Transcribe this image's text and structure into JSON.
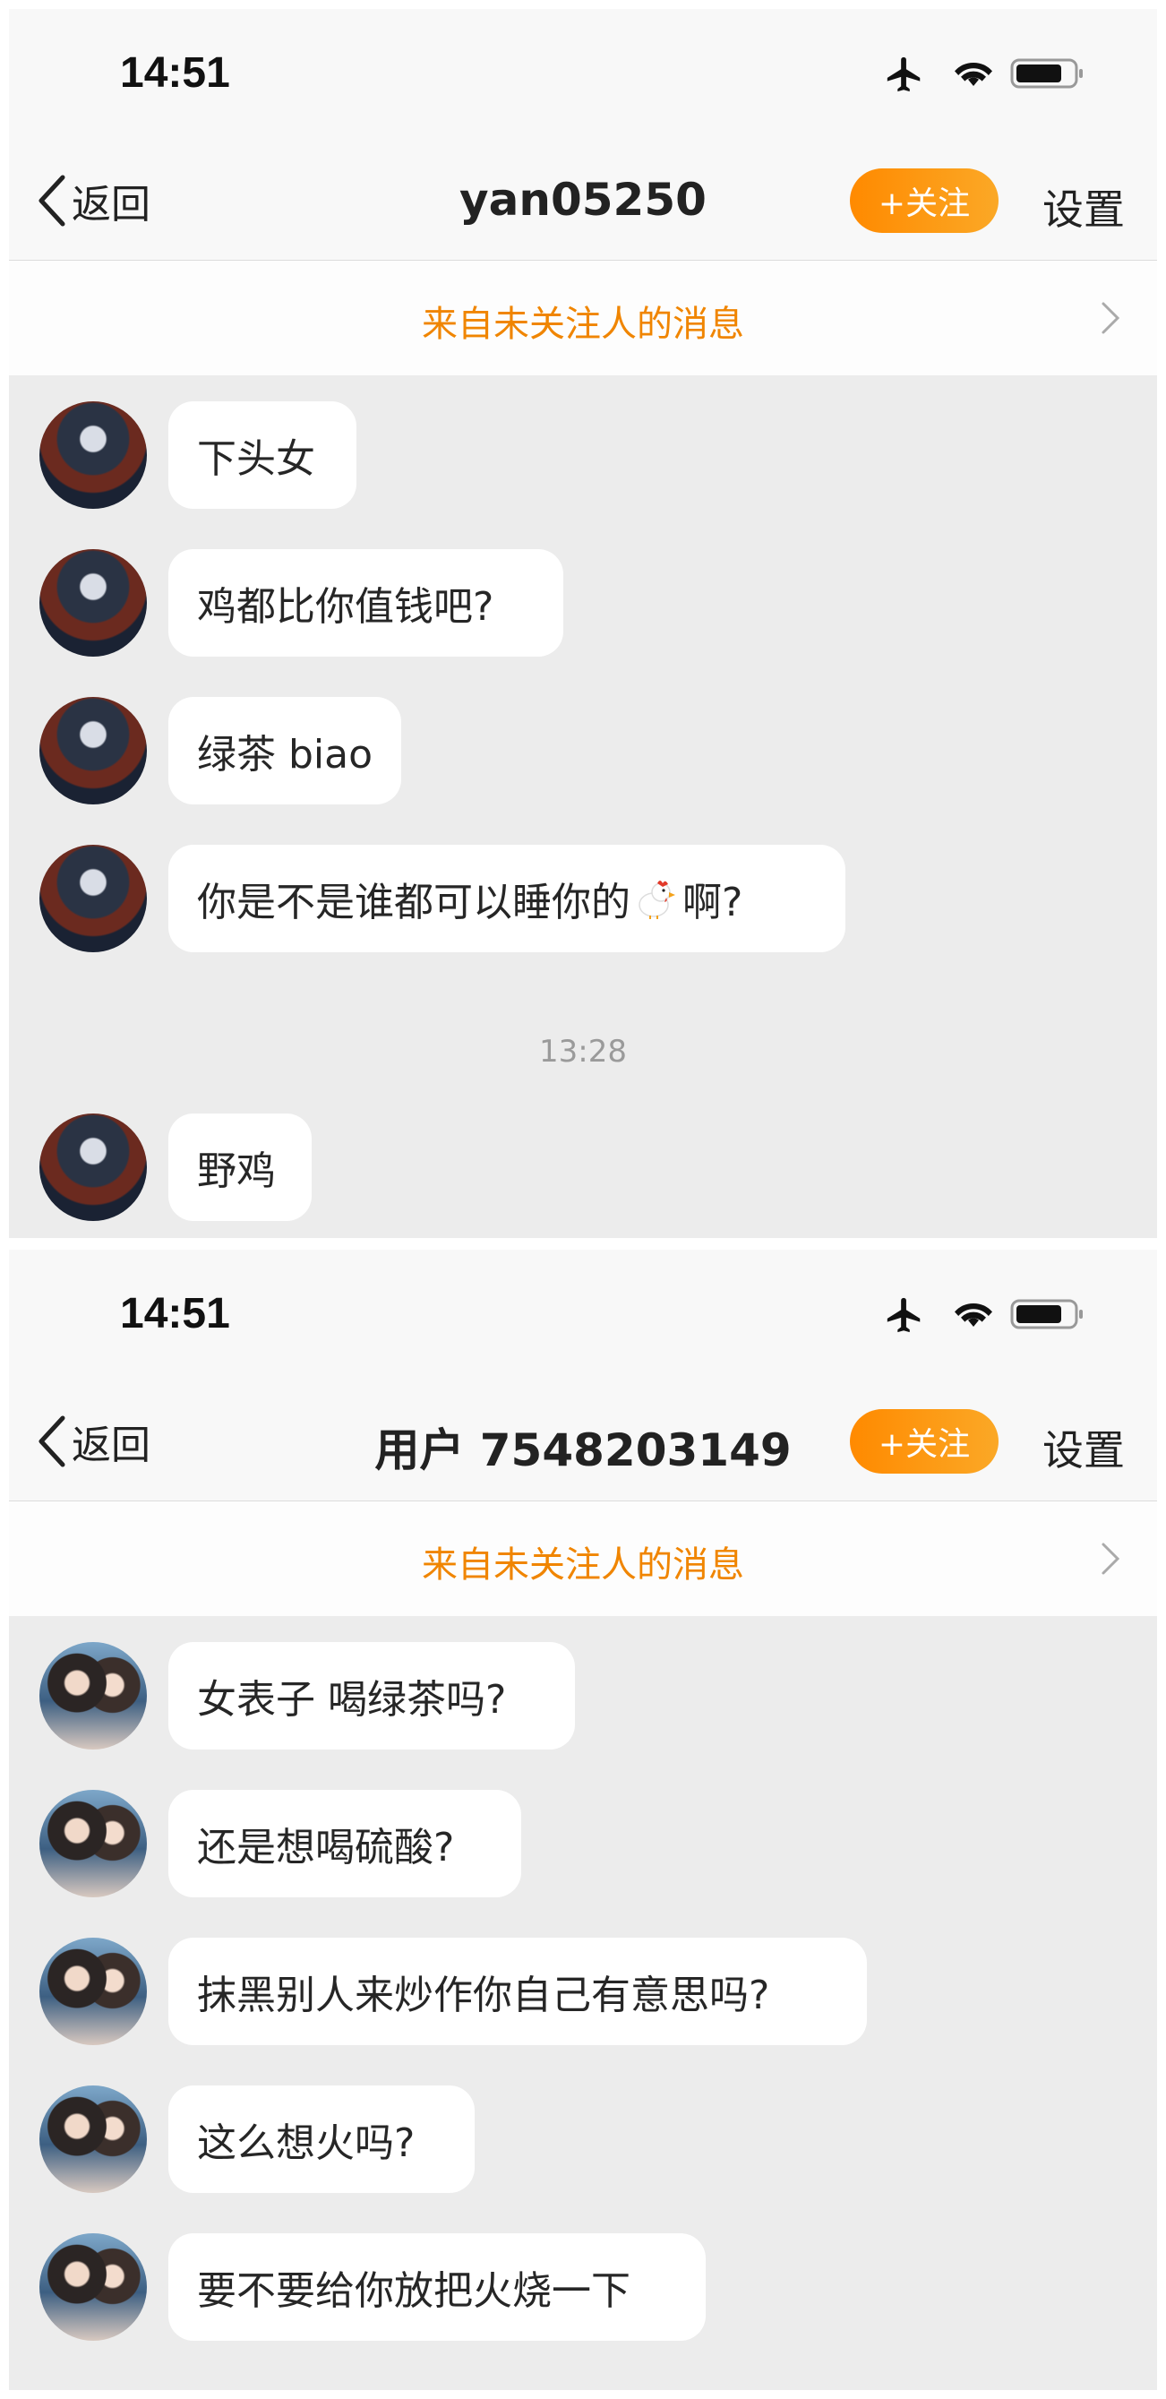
{
  "screens": [
    {
      "status": {
        "time": "14:51"
      },
      "nav": {
        "back_label": "返回",
        "title": "yan05250",
        "follow_label": "+关注",
        "settings_label": "设置"
      },
      "banner": {
        "text": "来自未关注人的消息"
      },
      "messages": [
        {
          "text": "下头女"
        },
        {
          "text": "鸡都比你值钱吧?"
        },
        {
          "text": "绿茶 biao"
        },
        {
          "text_before": "你是不是谁都可以睡你的",
          "emoji": "chicken",
          "text_after": "啊?"
        },
        {
          "text": "野鸡"
        }
      ],
      "timestamp": "13:28"
    },
    {
      "status": {
        "time": "14:51"
      },
      "nav": {
        "back_label": "返回",
        "title": "用户 7548203149",
        "follow_label": "+关注",
        "settings_label": "设置"
      },
      "banner": {
        "text": "来自未关注人的消息"
      },
      "messages": [
        {
          "text": "女表子 喝绿茶吗?"
        },
        {
          "text": "还是想喝硫酸?"
        },
        {
          "text": "抹黑别人来炒作你自己有意思吗?"
        },
        {
          "text": "这么想火吗?"
        },
        {
          "text": "要不要给你放把火烧一下"
        }
      ]
    }
  ],
  "colors": {
    "accent": "#f08500",
    "follow_gradient_start": "#ff8a00",
    "follow_gradient_end": "#fba826",
    "chat_bg": "#ececec",
    "bubble_bg": "#ffffff"
  },
  "icons": [
    "airplane-icon",
    "wifi-icon",
    "battery-icon",
    "back-chevron-icon",
    "chevron-right-icon",
    "chicken-emoji-icon"
  ]
}
